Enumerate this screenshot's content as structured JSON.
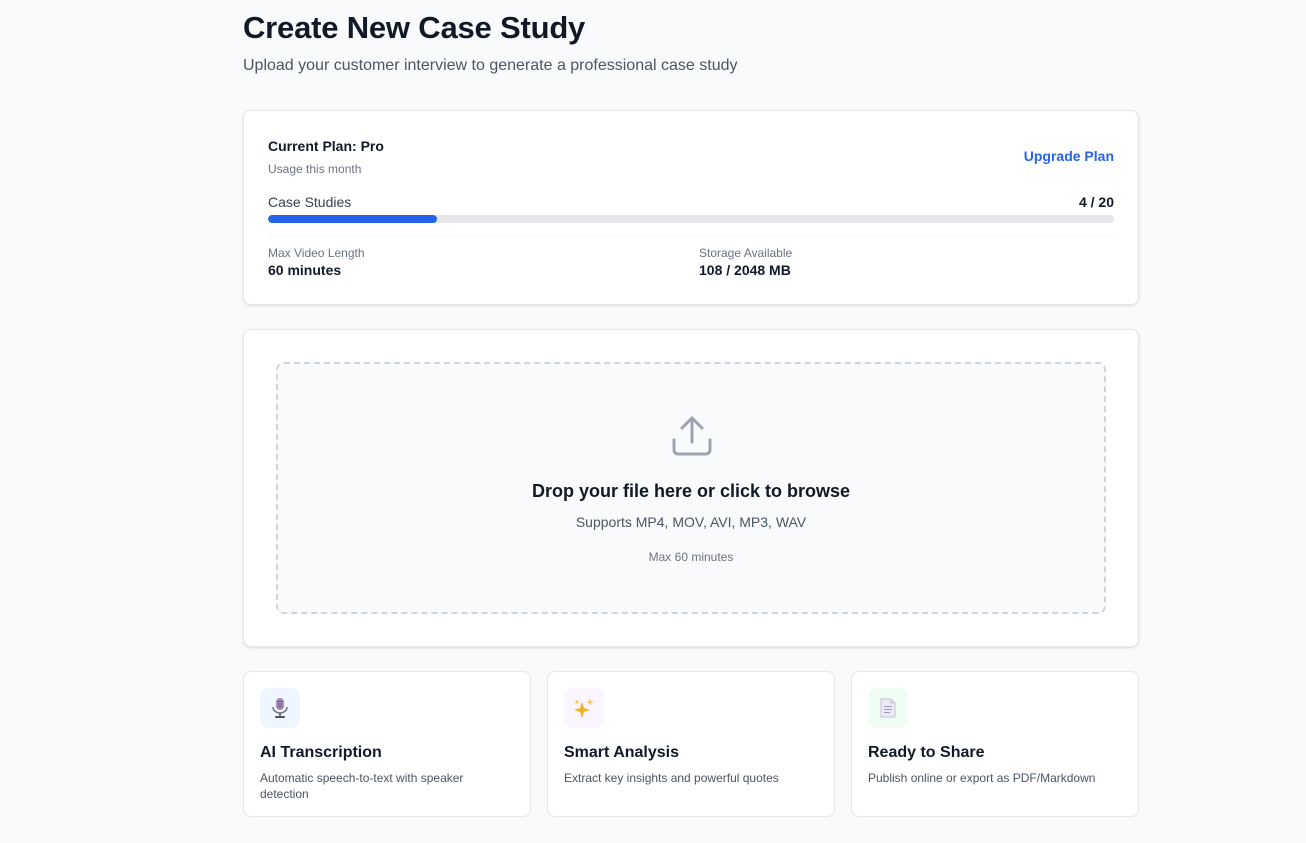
{
  "header": {
    "title": "Create New Case Study",
    "subtitle": "Upload your customer interview to generate a professional case study"
  },
  "plan": {
    "title": "Current Plan: Pro",
    "subtitle": "Usage this month",
    "upgrade_label": "Upgrade Plan",
    "usage_label": "Case Studies",
    "usage_count": "4 / 20",
    "usage_fraction": 0.2,
    "accent_color": "#2563eb",
    "stats": [
      {
        "label": "Max Video Length",
        "value": "60 minutes"
      },
      {
        "label": "Storage Available",
        "value": "108 / 2048 MB"
      }
    ]
  },
  "upload": {
    "icon": "upload-icon",
    "title": "Drop your file here or click to browse",
    "formats": "Supports MP4, MOV, AVI, MP3, WAV",
    "max": "Max 60 minutes"
  },
  "features": [
    {
      "icon": "microphone-icon",
      "icon_bg": "#eff6ff",
      "title": "AI Transcription",
      "description": "Automatic speech-to-text with speaker detection"
    },
    {
      "icon": "sparkles-icon",
      "icon_bg": "#faf5ff",
      "title": "Smart Analysis",
      "description": "Extract key insights and powerful quotes"
    },
    {
      "icon": "document-icon",
      "icon_bg": "#f0fdf4",
      "title": "Ready to Share",
      "description": "Publish online or export as PDF/Markdown"
    }
  ]
}
